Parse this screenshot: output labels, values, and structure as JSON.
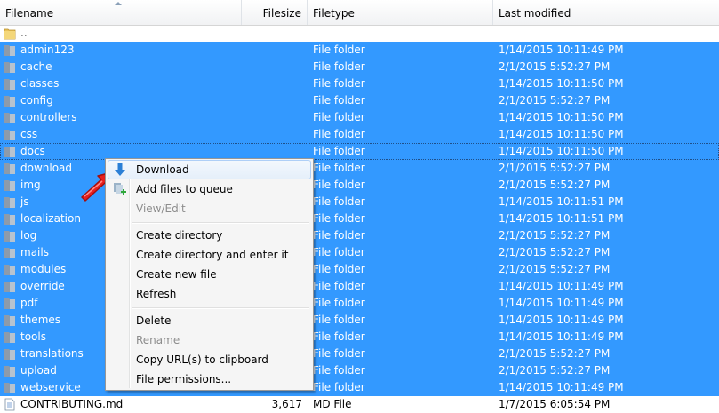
{
  "columns": {
    "filename": "Filename",
    "filesize": "Filesize",
    "filetype": "Filetype",
    "last_modified": "Last modified"
  },
  "parent_dir": "..",
  "rows": [
    {
      "name": "admin123",
      "type": "File folder",
      "modified": "1/14/2015 10:11:49 PM"
    },
    {
      "name": "cache",
      "type": "File folder",
      "modified": "2/1/2015 5:52:27 PM"
    },
    {
      "name": "classes",
      "type": "File folder",
      "modified": "1/14/2015 10:11:50 PM"
    },
    {
      "name": "config",
      "type": "File folder",
      "modified": "2/1/2015 5:52:27 PM"
    },
    {
      "name": "controllers",
      "type": "File folder",
      "modified": "1/14/2015 10:11:50 PM"
    },
    {
      "name": "css",
      "type": "File folder",
      "modified": "1/14/2015 10:11:50 PM"
    },
    {
      "name": "docs",
      "type": "File folder",
      "modified": "1/14/2015 10:11:50 PM"
    },
    {
      "name": "download",
      "type": "File folder",
      "modified": "2/1/2015 5:52:27 PM"
    },
    {
      "name": "img",
      "type": "File folder",
      "modified": "2/1/2015 5:52:27 PM"
    },
    {
      "name": "js",
      "type": "File folder",
      "modified": "1/14/2015 10:11:51 PM"
    },
    {
      "name": "localization",
      "type": "File folder",
      "modified": "1/14/2015 10:11:51 PM"
    },
    {
      "name": "log",
      "type": "File folder",
      "modified": "2/1/2015 5:52:27 PM"
    },
    {
      "name": "mails",
      "type": "File folder",
      "modified": "2/1/2015 5:52:27 PM"
    },
    {
      "name": "modules",
      "type": "File folder",
      "modified": "2/1/2015 5:52:27 PM"
    },
    {
      "name": "override",
      "type": "File folder",
      "modified": "1/14/2015 10:11:49 PM"
    },
    {
      "name": "pdf",
      "type": "File folder",
      "modified": "1/14/2015 10:11:49 PM"
    },
    {
      "name": "themes",
      "type": "File folder",
      "modified": "1/14/2015 10:11:49 PM"
    },
    {
      "name": "tools",
      "type": "File folder",
      "modified": "1/14/2015 10:11:49 PM"
    },
    {
      "name": "translations",
      "type": "File folder",
      "modified": "2/1/2015 5:52:27 PM"
    },
    {
      "name": "upload",
      "type": "File folder",
      "modified": "2/1/2015 5:52:27 PM"
    },
    {
      "name": "webservice",
      "type": "File folder",
      "modified": "1/14/2015 10:11:49 PM"
    },
    {
      "name": "CONTRIBUTING.md",
      "size": "3,617",
      "type": "MD File",
      "modified": "1/7/2015 6:05:54 PM"
    }
  ],
  "context_menu": {
    "items": [
      {
        "label": "Download",
        "icon": "download-arrow-icon"
      },
      {
        "label": "Add files to queue",
        "icon": "add-to-queue-icon"
      },
      {
        "label": "View/Edit"
      },
      {
        "label": "Create directory"
      },
      {
        "label": "Create directory and enter it"
      },
      {
        "label": "Create new file"
      },
      {
        "label": "Refresh"
      },
      {
        "label": "Delete"
      },
      {
        "label": "Rename"
      },
      {
        "label": "Copy URL(s) to clipboard"
      },
      {
        "label": "File permissions..."
      }
    ]
  },
  "colors": {
    "selection": "#3399ff",
    "pointer": "#e8201e"
  }
}
